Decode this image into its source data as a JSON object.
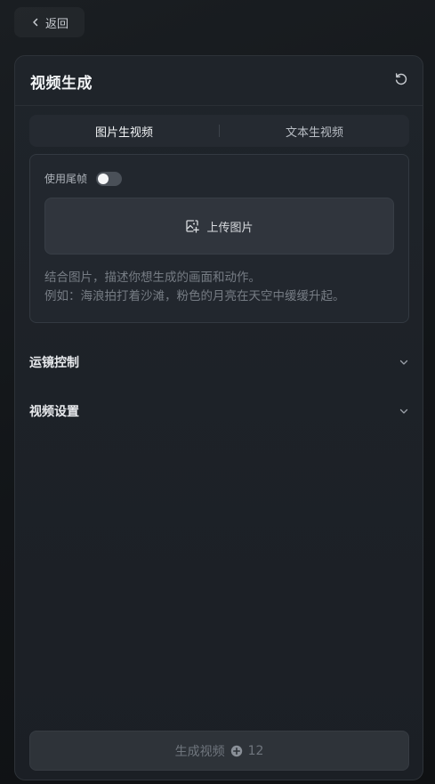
{
  "back": {
    "label": "返回"
  },
  "panel": {
    "title": "视频生成",
    "tabs": [
      {
        "label": "图片生视频",
        "active": true
      },
      {
        "label": "文本生视频",
        "active": false
      }
    ],
    "end_frame": {
      "label": "使用尾帧",
      "enabled": false
    },
    "upload": {
      "label": "上传图片"
    },
    "prompt": {
      "placeholder_line1": "结合图片，描述你想生成的画面和动作。",
      "placeholder_line2": "例如：海浪拍打着沙滩，粉色的月亮在天空中缓缓升起。"
    },
    "sections": [
      {
        "label": "运镜控制"
      },
      {
        "label": "视频设置"
      }
    ],
    "generate": {
      "label": "生成视频",
      "credits": "12"
    }
  },
  "icons": {
    "back": "chevron-left-icon",
    "reset": "refresh-icon",
    "upload": "image-plus-icon",
    "section": "chevron-down-icon",
    "credit": "credit-plus-icon"
  },
  "colors": {
    "background": "#14171a",
    "panel": "#1d2127",
    "toggle_off": "#4a5058"
  }
}
